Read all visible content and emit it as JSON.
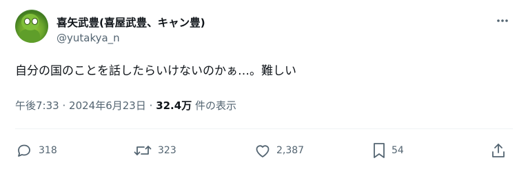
{
  "author": {
    "display_name": "喜矢武豊(喜屋武豊、キャン豊)",
    "handle": "@yutakya_n"
  },
  "tweet": {
    "text": "自分の国のことを話したらいけないのかぁ…。難しい"
  },
  "meta": {
    "time": "午後7:33",
    "separator1": "·",
    "date": "2024年6月23日",
    "separator2": "·",
    "views_count": "32.4万",
    "views_label": "件の表示"
  },
  "actions": {
    "replies": "318",
    "reposts": "323",
    "likes": "2,387",
    "bookmarks": "54"
  },
  "colors": {
    "text_primary": "#0f1419",
    "text_secondary": "#536471",
    "divider": "#eff3f4"
  }
}
